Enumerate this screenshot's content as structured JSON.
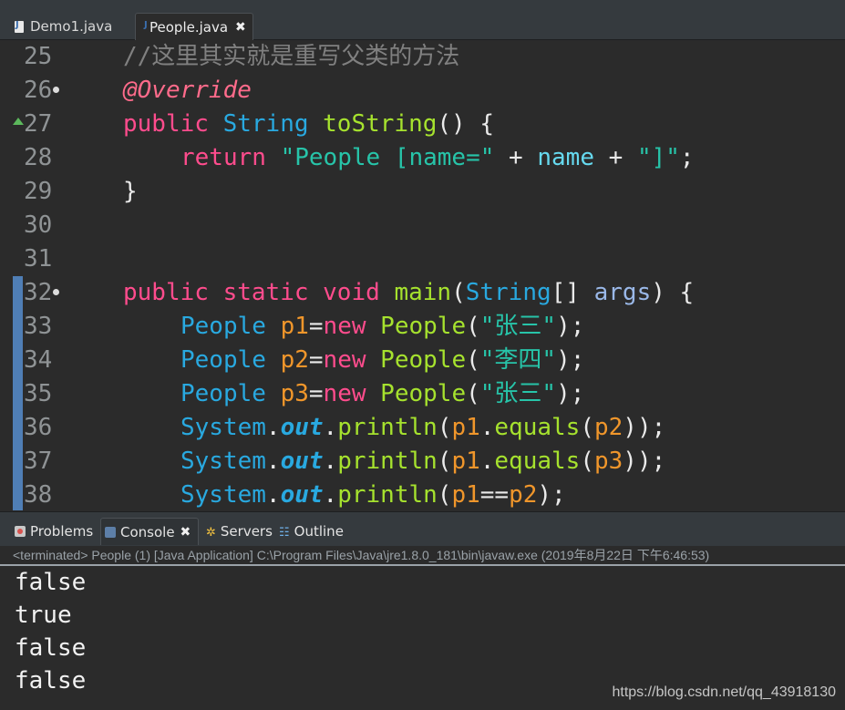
{
  "editor": {
    "tabs": [
      {
        "label": "Demo1.java",
        "active": false
      },
      {
        "label": "People.java",
        "active": true,
        "close": "✖"
      }
    ],
    "lines": [
      {
        "num": "25",
        "parts": [
          {
            "t": "//这里其实就是重写父类的方法",
            "c": "comment"
          }
        ]
      },
      {
        "num": "26",
        "parts": [
          {
            "t": "@Override",
            "c": "anno"
          }
        ]
      },
      {
        "num": "27",
        "parts": [
          {
            "t": "public",
            "c": "kw"
          },
          {
            "t": " ",
            "c": "default"
          },
          {
            "t": "String",
            "c": "type"
          },
          {
            "t": " ",
            "c": "default"
          },
          {
            "t": "toString",
            "c": "method"
          },
          {
            "t": "() {",
            "c": "default"
          }
        ]
      },
      {
        "num": "28",
        "parts": [
          {
            "t": "return",
            "c": "kw"
          },
          {
            "t": " ",
            "c": "default"
          },
          {
            "t": "\"People [name=\"",
            "c": "string"
          },
          {
            "t": " + ",
            "c": "default"
          },
          {
            "t": "name",
            "c": "field"
          },
          {
            "t": " + ",
            "c": "default"
          },
          {
            "t": "\"]\"",
            "c": "string"
          },
          {
            "t": ";",
            "c": "default"
          }
        ]
      },
      {
        "num": "29",
        "parts": [
          {
            "t": "}",
            "c": "default"
          }
        ]
      },
      {
        "num": "30",
        "parts": []
      },
      {
        "num": "31",
        "parts": []
      },
      {
        "num": "32",
        "parts": [
          {
            "t": "public",
            "c": "kw"
          },
          {
            "t": " ",
            "c": "default"
          },
          {
            "t": "static",
            "c": "kw"
          },
          {
            "t": " ",
            "c": "default"
          },
          {
            "t": "void",
            "c": "kw"
          },
          {
            "t": " ",
            "c": "default"
          },
          {
            "t": "main",
            "c": "method"
          },
          {
            "t": "(",
            "c": "default"
          },
          {
            "t": "String",
            "c": "type"
          },
          {
            "t": "[] ",
            "c": "default"
          },
          {
            "t": "args",
            "c": "param"
          },
          {
            "t": ") {",
            "c": "default"
          }
        ]
      },
      {
        "num": "33",
        "parts": [
          {
            "t": "People",
            "c": "type"
          },
          {
            "t": " ",
            "c": "default"
          },
          {
            "t": "p1",
            "c": "var"
          },
          {
            "t": "=",
            "c": "default"
          },
          {
            "t": "new",
            "c": "kw"
          },
          {
            "t": " ",
            "c": "default"
          },
          {
            "t": "People",
            "c": "method"
          },
          {
            "t": "(",
            "c": "default"
          },
          {
            "t": "\"张三\"",
            "c": "string"
          },
          {
            "t": ");",
            "c": "default"
          }
        ]
      },
      {
        "num": "34",
        "parts": [
          {
            "t": "People",
            "c": "type"
          },
          {
            "t": " ",
            "c": "default"
          },
          {
            "t": "p2",
            "c": "var"
          },
          {
            "t": "=",
            "c": "default"
          },
          {
            "t": "new",
            "c": "kw"
          },
          {
            "t": " ",
            "c": "default"
          },
          {
            "t": "People",
            "c": "method"
          },
          {
            "t": "(",
            "c": "default"
          },
          {
            "t": "\"李四\"",
            "c": "string"
          },
          {
            "t": ");",
            "c": "default"
          }
        ]
      },
      {
        "num": "35",
        "parts": [
          {
            "t": "People",
            "c": "type"
          },
          {
            "t": " ",
            "c": "default"
          },
          {
            "t": "p3",
            "c": "var"
          },
          {
            "t": "=",
            "c": "default"
          },
          {
            "t": "new",
            "c": "kw"
          },
          {
            "t": " ",
            "c": "default"
          },
          {
            "t": "People",
            "c": "method"
          },
          {
            "t": "(",
            "c": "default"
          },
          {
            "t": "\"张三\"",
            "c": "string"
          },
          {
            "t": ");",
            "c": "default"
          }
        ]
      },
      {
        "num": "36",
        "parts": [
          {
            "t": "System",
            "c": "type"
          },
          {
            "t": ".",
            "c": "default"
          },
          {
            "t": "out",
            "c": "static"
          },
          {
            "t": ".",
            "c": "default"
          },
          {
            "t": "println",
            "c": "call"
          },
          {
            "t": "(",
            "c": "default"
          },
          {
            "t": "p1",
            "c": "var"
          },
          {
            "t": ".",
            "c": "default"
          },
          {
            "t": "equals",
            "c": "call"
          },
          {
            "t": "(",
            "c": "default"
          },
          {
            "t": "p2",
            "c": "var"
          },
          {
            "t": "));",
            "c": "default"
          }
        ]
      },
      {
        "num": "37",
        "parts": [
          {
            "t": "System",
            "c": "type"
          },
          {
            "t": ".",
            "c": "default"
          },
          {
            "t": "out",
            "c": "static"
          },
          {
            "t": ".",
            "c": "default"
          },
          {
            "t": "println",
            "c": "call"
          },
          {
            "t": "(",
            "c": "default"
          },
          {
            "t": "p1",
            "c": "var"
          },
          {
            "t": ".",
            "c": "default"
          },
          {
            "t": "equals",
            "c": "call"
          },
          {
            "t": "(",
            "c": "default"
          },
          {
            "t": "p3",
            "c": "var"
          },
          {
            "t": "));",
            "c": "default"
          }
        ]
      },
      {
        "num": "38",
        "parts": [
          {
            "t": "System",
            "c": "type"
          },
          {
            "t": ".",
            "c": "default"
          },
          {
            "t": "out",
            "c": "static"
          },
          {
            "t": ".",
            "c": "default"
          },
          {
            "t": "println",
            "c": "call"
          },
          {
            "t": "(",
            "c": "default"
          },
          {
            "t": "p1",
            "c": "var"
          },
          {
            "t": "==",
            "c": "default"
          },
          {
            "t": "p2",
            "c": "var"
          },
          {
            "t": ");",
            "c": "default"
          }
        ]
      }
    ]
  },
  "console": {
    "tabs": [
      {
        "label": "Problems",
        "icon": "problems-icon"
      },
      {
        "label": "Console",
        "icon": "console-icon",
        "close": "✖"
      },
      {
        "label": "Servers",
        "icon": "servers-icon"
      },
      {
        "label": "Outline",
        "icon": "outline-icon"
      }
    ],
    "status": "<terminated> People (1) [Java Application] C:\\Program Files\\Java\\jre1.8.0_181\\bin\\javaw.exe (2019年8月22日 下午6:46:53)",
    "output": [
      "false",
      "true",
      "false",
      "false"
    ]
  },
  "watermark": "https://blog.csdn.net/qq_43918130",
  "colors": {
    "background": "#2b2b2b",
    "keyword": "#ff4c8d",
    "type": "#29a9e0",
    "method": "#a6e22e",
    "string": "#27c4a9",
    "variable": "#f0962b",
    "comment": "#808080"
  }
}
